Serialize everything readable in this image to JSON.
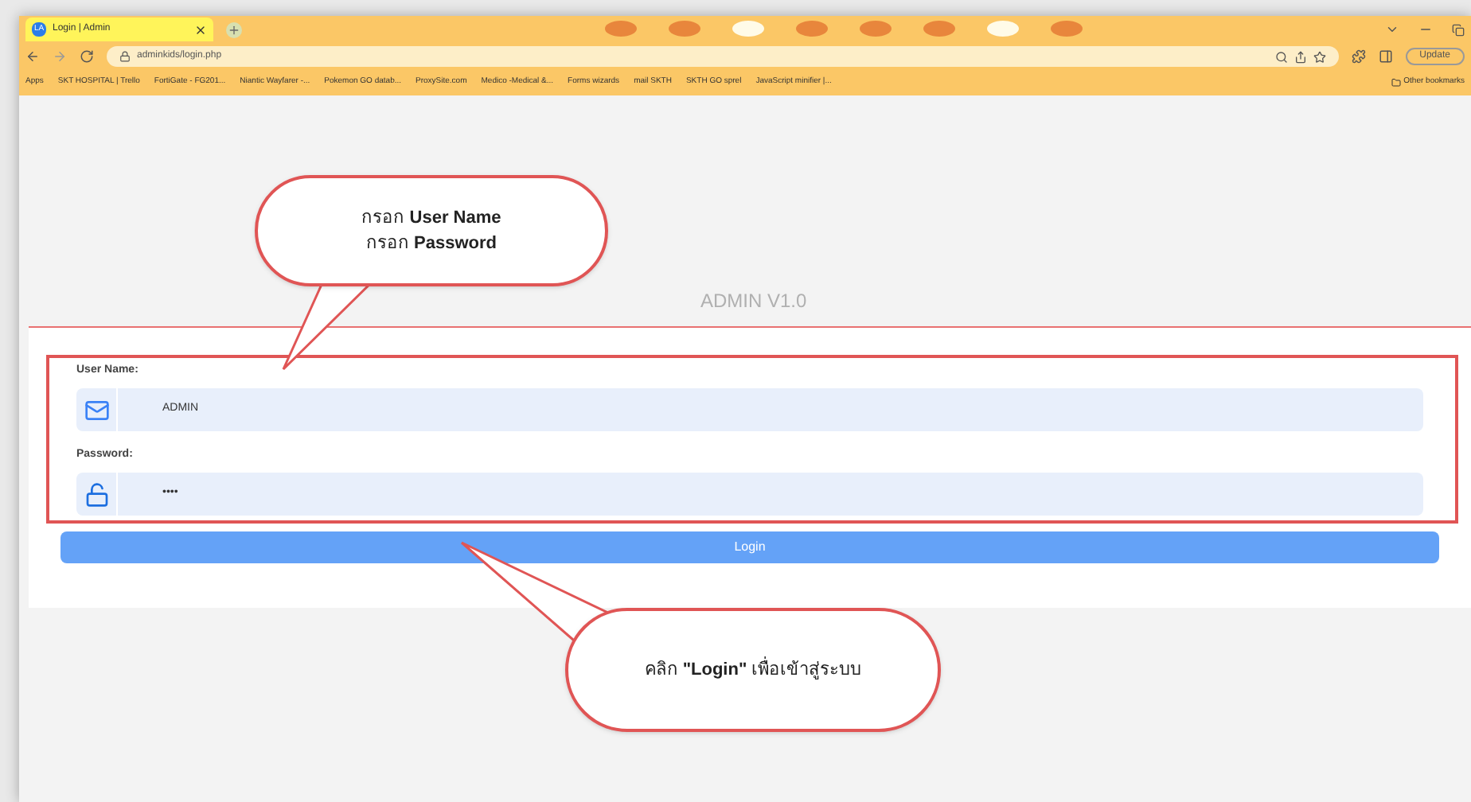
{
  "browser": {
    "tab": {
      "title": "Login | Admin",
      "favicon": "LA"
    },
    "address": "adminkids/login.php",
    "update_button": "Update",
    "bookmarks": [
      "Apps",
      "SKT HOSPITAL | Trello",
      "FortiGate - FG201...",
      "Niantic Wayfarer -...",
      "Pokemon GO datab...",
      "ProxySite.com",
      "Medico -Medical &...",
      "Forms wizards",
      "mail SKTH",
      "SKTH GO sprel",
      "JavaScript minifier |..."
    ],
    "other_bookmarks": "Other bookmarks"
  },
  "page": {
    "heading": "ADMIN V1.0",
    "fields": [
      {
        "label": "User Name:",
        "value": "ADMIN",
        "kind": "email"
      },
      {
        "label": "Password:",
        "value": "••••",
        "kind": "password"
      }
    ],
    "login_button": "Login"
  },
  "callouts": [
    {
      "lines": [
        "กรอก **User Name**",
        "กรอก **Password**"
      ]
    },
    {
      "lines": [
        "คลิก **\"Login\"** เพื่อเข้าสู่ระบบ"
      ]
    }
  ]
}
